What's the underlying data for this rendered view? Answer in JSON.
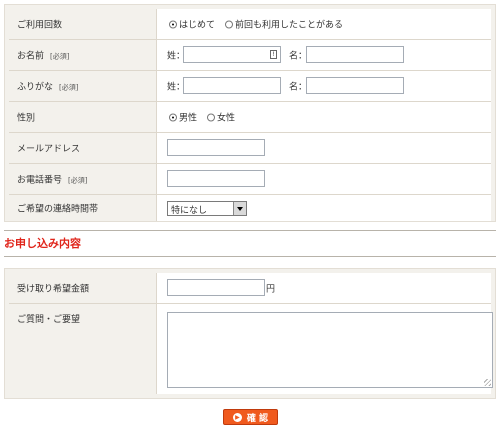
{
  "form1": {
    "usage": {
      "label": "ご利用回数",
      "options": [
        {
          "label": "はじめて",
          "selected": true
        },
        {
          "label": "前回も利用したことがある",
          "selected": false
        }
      ]
    },
    "name": {
      "label": "お名前",
      "required": "[必須]",
      "last_label": "姓：",
      "first_label": "名：",
      "last_value": "",
      "first_value": ""
    },
    "furigana": {
      "label": "ふりがな",
      "required": "[必須]",
      "last_label": "姓：",
      "first_label": "名：",
      "last_value": "",
      "first_value": ""
    },
    "gender": {
      "label": "性別",
      "options": [
        {
          "label": "男性",
          "selected": true
        },
        {
          "label": "女性",
          "selected": false
        }
      ]
    },
    "email": {
      "label": "メールアドレス",
      "value": ""
    },
    "phone": {
      "label": "お電話番号",
      "required": "[必須]",
      "value": ""
    },
    "contact_time": {
      "label": "ご希望の連絡時間帯",
      "selected": "特になし"
    }
  },
  "section": {
    "title": "お申し込み内容"
  },
  "form2": {
    "amount": {
      "label": "受け取り希望金額",
      "value": "",
      "unit": "円"
    },
    "question": {
      "label": "ご質問・ご要望",
      "value": ""
    }
  },
  "confirm_button": {
    "label": "確 認",
    "icon": "arrow-right-icon"
  }
}
